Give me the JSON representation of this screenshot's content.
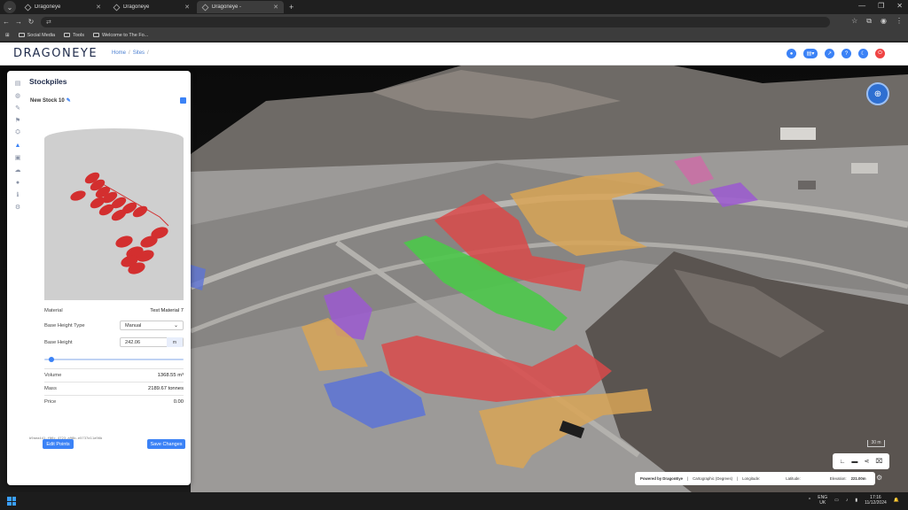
{
  "browser": {
    "tabs": [
      {
        "title": "Dragoneye",
        "active": false
      },
      {
        "title": "Dragoneye",
        "active": false
      },
      {
        "title": "Dragoneye -",
        "active": true
      }
    ],
    "bookmarks": [
      "Social Media",
      "Tools",
      "Welcome to The Fo..."
    ]
  },
  "app": {
    "logo": "DRAGONEYE",
    "breadcrumb": [
      "Home",
      "Sites"
    ],
    "breadcrumb_sep": "/"
  },
  "panel": {
    "title": "Stockpiles",
    "stock_name": "New Stock 10",
    "material_label": "Material",
    "material_value": "Test Material 7",
    "base_height_type_label": "Base Height Type",
    "base_height_type_value": "Manual",
    "base_height_label": "Base Height",
    "base_height_value": "242.06",
    "base_height_unit": "m",
    "slider_fraction": 0.03,
    "volume_label": "Volume",
    "volume_value": "1368.55 m³",
    "mass_label": "Mass",
    "mass_value": "2189.67 tonnes",
    "price_label": "Price",
    "price_value": "0.00",
    "edit_button": "Edit Points",
    "save_button": "Save Changes",
    "uuid": "b9aea441-f06c-4723-a98b-e5737d11a96b"
  },
  "map": {
    "scale": "30 m",
    "status": {
      "powered": "Powered by DragonEye",
      "crs": "Cartographic (Degrees)",
      "longitude_label": "Longitude:",
      "latitude_label": "Latitude:",
      "elevation_label": "Elevation:",
      "elevation_value": "221.00m"
    }
  },
  "taskbar": {
    "lang": "ENG",
    "region": "UK",
    "time": "17:16",
    "date": "11/12/2024"
  },
  "colors": {
    "accent": "#3b82f6",
    "stock_red": "#d94a4a",
    "stock_orange": "#d8a456",
    "stock_green": "#4cc84a",
    "stock_purple": "#9b59d0",
    "stock_blue": "#5c73d6",
    "stock_pink": "#d06aa8"
  }
}
